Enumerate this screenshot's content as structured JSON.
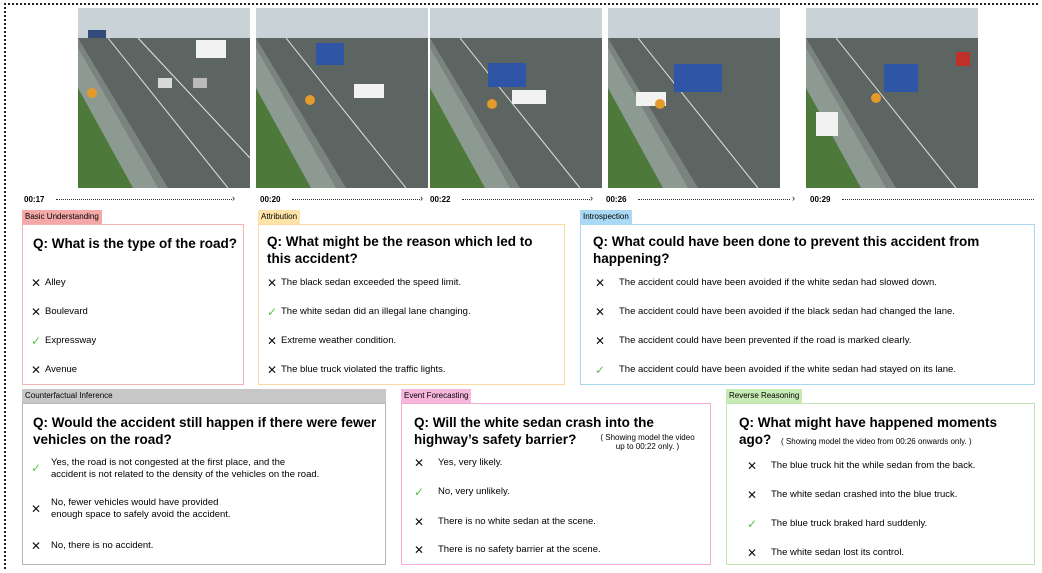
{
  "timeline": {
    "timestamps": [
      "00:17",
      "00:20",
      "00:22",
      "00:26",
      "00:29"
    ]
  },
  "panels": {
    "basic": {
      "tag": "Basic Understanding",
      "tag_color": "#f4a9a8",
      "border_color": "#f4b2b0",
      "question": "Q: What is the type of the road?",
      "options": [
        {
          "mark": "✕",
          "correct": false,
          "text": "Alley"
        },
        {
          "mark": "✕",
          "correct": false,
          "text": "Boulevard"
        },
        {
          "mark": "✓",
          "correct": true,
          "text": "Expressway"
        },
        {
          "mark": "✕",
          "correct": false,
          "text": "Avenue"
        }
      ]
    },
    "attribution": {
      "tag": "Attribution",
      "tag_color": "#fde3a7",
      "border_color": "#fcd9a0",
      "question": "Q: What might be the reason which led to this accident?",
      "options": [
        {
          "mark": "✕",
          "correct": false,
          "text": "The black sedan exceeded the speed limit."
        },
        {
          "mark": "✓",
          "correct": true,
          "text": "The white sedan did an illegal lane changing."
        },
        {
          "mark": "✕",
          "correct": false,
          "text": "Extreme weather condition."
        },
        {
          "mark": "✕",
          "correct": false,
          "text": "The blue truck violated the traffic lights."
        }
      ]
    },
    "introspection": {
      "tag": "Introspection",
      "tag_color": "#a9d9f4",
      "border_color": "#a9d7f0",
      "question": "Q: What could have been done to prevent this accident from happening?",
      "options": [
        {
          "mark": "✕",
          "correct": false,
          "text": "The accident could have been avoided if the white sedan had slowed down."
        },
        {
          "mark": "✕",
          "correct": false,
          "text": "The accident could have been avoided if the black sedan had changed the lane."
        },
        {
          "mark": "✕",
          "correct": false,
          "text": "The accident could have been prevented if the road is marked clearly."
        },
        {
          "mark": "✓",
          "correct": true,
          "text": "The accident could have been avoided if the white sedan had stayed on its lane."
        }
      ]
    },
    "counterfactual": {
      "tag": "Counterfactual Inference",
      "tag_color": "#c7c7c7",
      "border_color": "#b7b7b7",
      "question": "Q: Would the accident still happen if there were fewer vehicles on the road?",
      "options": [
        {
          "mark": "✓",
          "correct": true,
          "text_lines": [
            "Yes, the road is not congested at the first place, and the",
            "accident is not related to the density of the vehicles on the road."
          ]
        },
        {
          "mark": "✕",
          "correct": false,
          "text_lines": [
            "No, fewer vehicles would have provided",
            "enough space to safely avoid the accident."
          ]
        },
        {
          "mark": "✕",
          "correct": false,
          "text_lines": [
            "No, there is no accident."
          ]
        }
      ]
    },
    "forecasting": {
      "tag": "Event Forecasting",
      "tag_color": "#f7b6dc",
      "border_color": "#f5a9d6",
      "question": "Q: Will the white sedan crash into the highway’s safety barrier?",
      "note_lines": [
        "( Showing model the video",
        "up to 00:22 only. )"
      ],
      "options": [
        {
          "mark": "✕",
          "correct": false,
          "text": "Yes, very likely."
        },
        {
          "mark": "✓",
          "correct": true,
          "text": "No, very unlikely."
        },
        {
          "mark": "✕",
          "correct": false,
          "text": "There is no white sedan at the scene."
        },
        {
          "mark": "✕",
          "correct": false,
          "text": "There is no safety barrier at the scene."
        }
      ]
    },
    "reverse": {
      "tag": "Reverse Reasoning",
      "tag_color": "#c6ebb5",
      "border_color": "#bfe6ad",
      "question_line1": "Q: What might have happened moments",
      "question_line2": "ago?",
      "note": "( Showing model the video from 00:26 onwards only. )",
      "options": [
        {
          "mark": "✕",
          "correct": false,
          "text": "The blue truck hit the while sedan from the back."
        },
        {
          "mark": "✕",
          "correct": false,
          "text": "The white sedan crashed into the blue truck."
        },
        {
          "mark": "✓",
          "correct": true,
          "text": "The blue truck braked hard suddenly."
        },
        {
          "mark": "✕",
          "correct": false,
          "text": "The white sedan lost its control."
        }
      ]
    }
  },
  "colors": {
    "check": "#5cbf4f",
    "cross": "#111111"
  }
}
